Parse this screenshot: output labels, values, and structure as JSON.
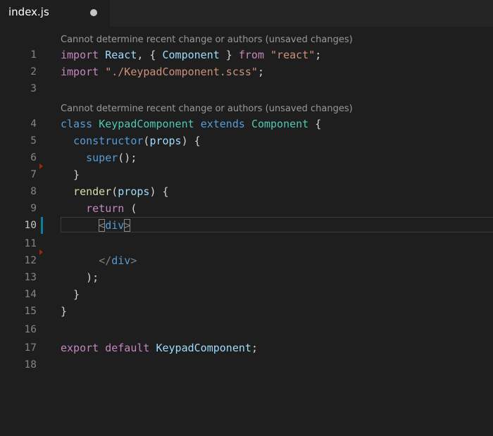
{
  "tab": {
    "title": "index.js",
    "dirty": true
  },
  "codelens": [
    "Cannot determine recent change or authors (unsaved changes)",
    "Cannot determine recent change or authors (unsaved changes)"
  ],
  "lines": [
    {
      "num": "1",
      "t": [
        "import",
        " ",
        "React",
        ", { ",
        "Component",
        " } ",
        "from",
        " ",
        "\"react\"",
        ";"
      ]
    },
    {
      "num": "2",
      "t": [
        "import",
        " ",
        "\"./KeypadComponent.scss\"",
        ";"
      ]
    },
    {
      "num": "3"
    },
    {
      "num": "4",
      "t": [
        "class",
        " ",
        "KeypadComponent",
        " ",
        "extends",
        " ",
        "Component",
        " {"
      ]
    },
    {
      "num": "5",
      "t": [
        "  ",
        "constructor",
        "(",
        "props",
        ") {"
      ]
    },
    {
      "num": "6",
      "t": [
        "    ",
        "super",
        "();"
      ]
    },
    {
      "num": "7",
      "t": [
        "  }"
      ]
    },
    {
      "num": "8",
      "t": [
        "  ",
        "render",
        "(",
        "props",
        ") {"
      ]
    },
    {
      "num": "9",
      "t": [
        "    ",
        "return",
        " ("
      ]
    },
    {
      "num": "10",
      "t": [
        "      ",
        "<",
        "div",
        ">"
      ]
    },
    {
      "num": "11"
    },
    {
      "num": "12",
      "t": [
        "      ",
        "</",
        "div",
        ">"
      ]
    },
    {
      "num": "13",
      "t": [
        "    );"
      ]
    },
    {
      "num": "14",
      "t": [
        "  }"
      ]
    },
    {
      "num": "15",
      "t": [
        "}"
      ]
    },
    {
      "num": "16"
    },
    {
      "num": "17",
      "t": [
        "export",
        " ",
        "default",
        " ",
        "KeypadComponent",
        ";"
      ]
    },
    {
      "num": "18"
    }
  ],
  "colors": {
    "background": "#1e1e1e",
    "keyword_blue": "#569cd6",
    "keyword_purple": "#c586c0",
    "type": "#4ec9b0",
    "variable": "#9cdcfe",
    "string": "#ce9178",
    "function": "#dcdcaa",
    "modified_bar": "#0c7d9d",
    "deleted_marker": "#a1260d"
  }
}
